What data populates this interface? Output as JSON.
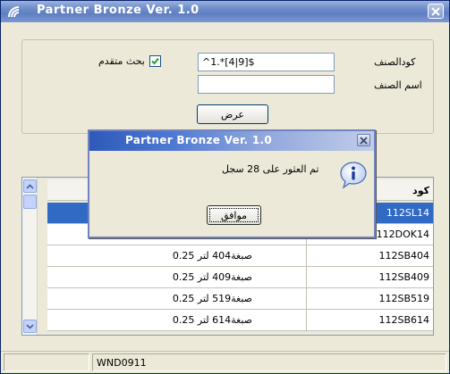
{
  "window": {
    "title": "Partner Bronze Ver. 1.0"
  },
  "search": {
    "code_label": "كودالصنف",
    "name_label": "اسم الصنف",
    "code_value": "^1.*[4|9]$",
    "name_value": "",
    "advanced_label": "بحث متقدم",
    "advanced_checked": true,
    "show_button": "عرض"
  },
  "grid": {
    "header_code": "كود",
    "rows": [
      {
        "code": "112SL14",
        "name": "",
        "selected": true
      },
      {
        "code": "112DOK14",
        "name": ""
      },
      {
        "code": "112SB404",
        "name": "صبغة404 لتر 0.25"
      },
      {
        "code": "112SB409",
        "name": "صبغة409 لتر 0.25"
      },
      {
        "code": "112SB519",
        "name": "صبغة519 لتر 0.25"
      },
      {
        "code": "112SB614",
        "name": "صبغة614 لتر 0.25"
      }
    ]
  },
  "status": {
    "panel1": "",
    "panel2": "WND0911"
  },
  "dialog": {
    "title": "Partner Bronze Ver. 1.0",
    "message": "تم العثور على 28 سجل",
    "ok_button": "موافق"
  },
  "icons": {
    "app": "app-signal-icon",
    "info": "info-speech-bubble-icon",
    "close": "close-x-icon"
  }
}
